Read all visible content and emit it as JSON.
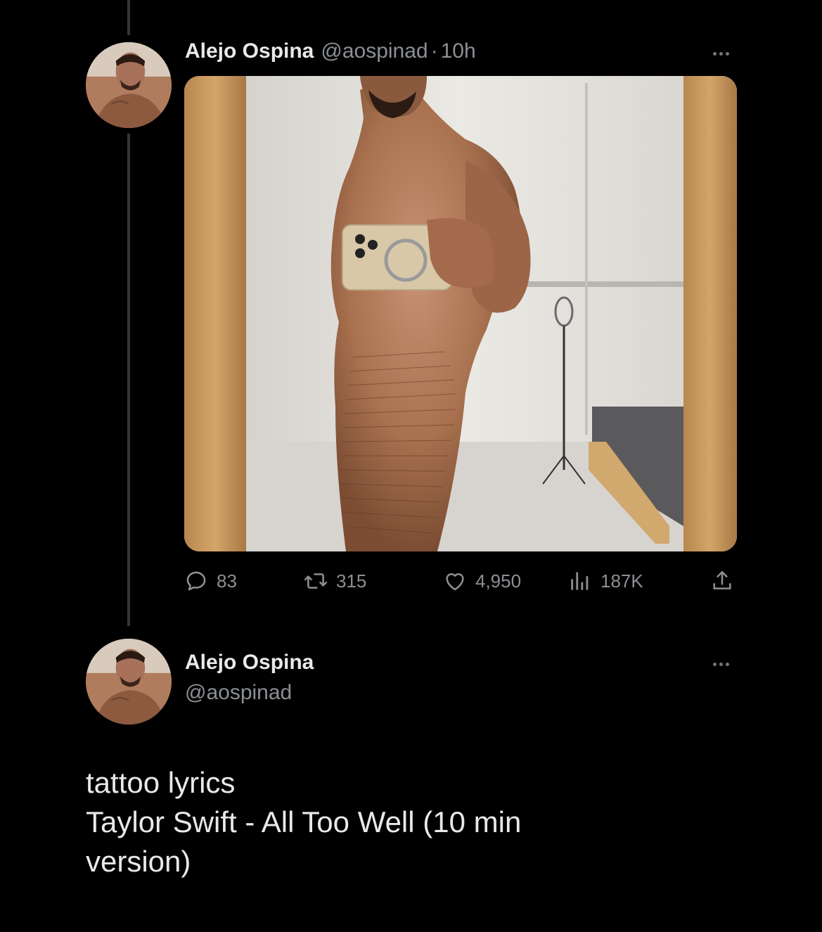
{
  "tweet1": {
    "author_name": "Alejo Ospina",
    "author_handle": "@aospinad",
    "separator": "·",
    "time": "10h",
    "stats": {
      "replies": "83",
      "retweets": "315",
      "likes": "4,950",
      "views": "187K"
    },
    "icons": {
      "reply": "reply-icon",
      "retweet": "retweet-icon",
      "like": "heart-icon",
      "views": "views-icon",
      "share": "share-icon",
      "more": "more-icon"
    }
  },
  "tweet2": {
    "author_name": "Alejo Ospina",
    "author_handle": "@aospinad",
    "text_lines": [
      "tattoo lyrics",
      "Taylor Swift - All Too Well (10 min",
      "version)"
    ]
  },
  "colors": {
    "background": "#000000",
    "primary_text": "#e7e9ea",
    "secondary_text": "#8b8f94",
    "thread_line": "#333639"
  }
}
